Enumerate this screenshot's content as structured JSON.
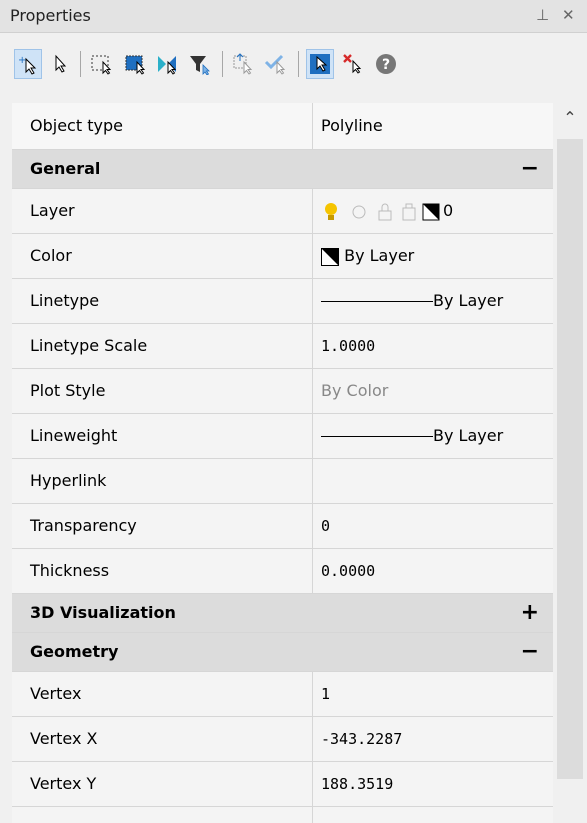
{
  "window": {
    "title": "Properties",
    "pin_icon": "pin-icon",
    "close_icon": "close-icon"
  },
  "toolbar": {
    "tools": [
      "add-to-selection-icon",
      "select-object-icon",
      "quick-select-window-icon",
      "select-similar-icon",
      "quick-select-icon",
      "filter-icon",
      "match-properties-icon",
      "check-selection-icon",
      "pickadd-icon",
      "deselect-all-icon",
      "help-icon"
    ]
  },
  "grid": {
    "object_type": {
      "label": "Object type",
      "value": "Polyline"
    },
    "categories": [
      {
        "label": "General",
        "toggle": "−",
        "rows": [
          {
            "label": "Layer",
            "value": "0"
          },
          {
            "label": "Color",
            "value": "By Layer"
          },
          {
            "label": "Linetype",
            "value": "By Layer"
          },
          {
            "label": "Linetype Scale",
            "value": "1.0000"
          },
          {
            "label": "Plot Style",
            "value": "By Color"
          },
          {
            "label": "Lineweight",
            "value": "By Layer"
          },
          {
            "label": "Hyperlink",
            "value": ""
          },
          {
            "label": "Transparency",
            "value": "0"
          },
          {
            "label": "Thickness",
            "value": "0.0000"
          }
        ]
      },
      {
        "label": "3D Visualization",
        "toggle": "+",
        "rows": []
      },
      {
        "label": "Geometry",
        "toggle": "−",
        "rows": [
          {
            "label": "Vertex",
            "value": "1"
          },
          {
            "label": "Vertex X",
            "value": "-343.2287"
          },
          {
            "label": "Vertex Y",
            "value": "188.3519"
          }
        ]
      }
    ]
  },
  "colors": {
    "lightbulb": "#f5c400",
    "selected_tool": "#cfe3f7",
    "category_bg": "#dcdcdc"
  }
}
